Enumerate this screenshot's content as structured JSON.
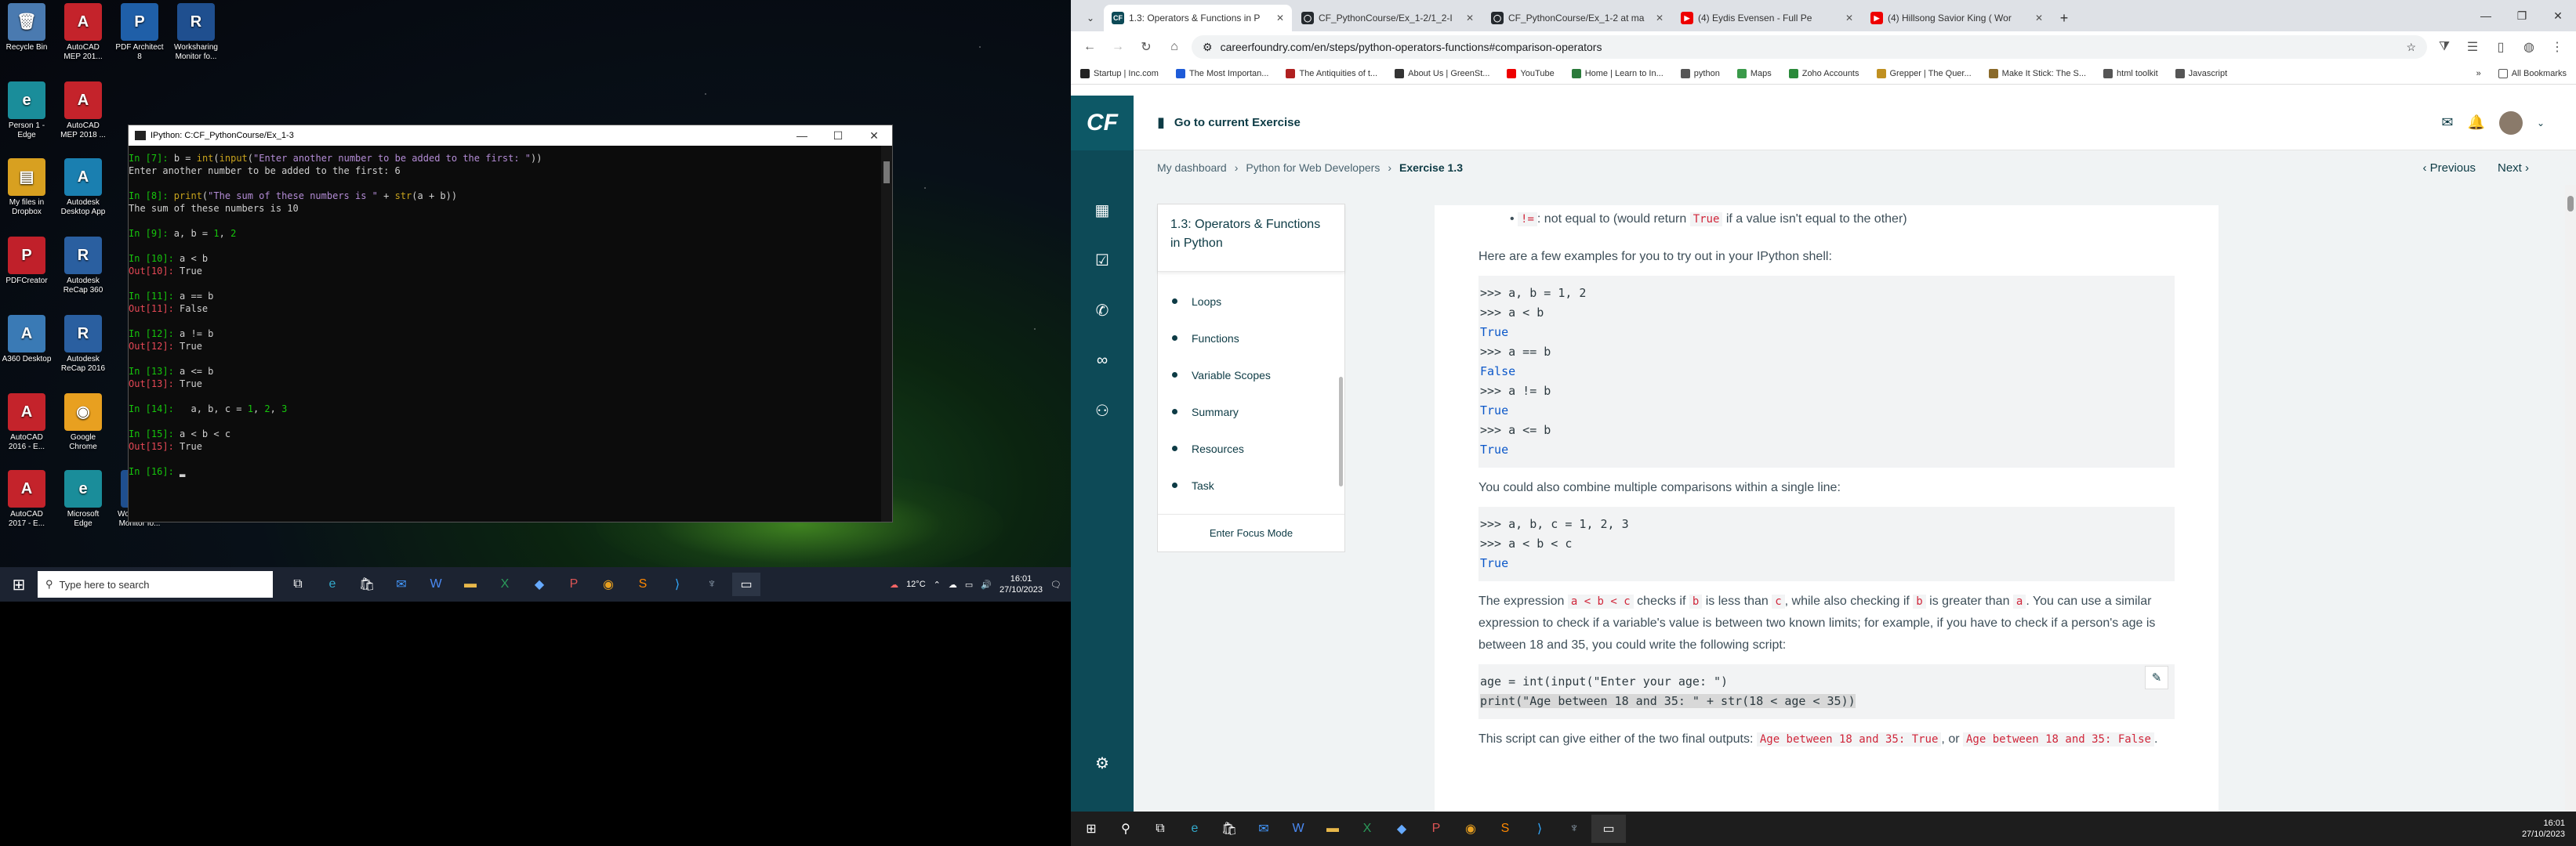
{
  "desktop": {
    "icons": [
      {
        "label": "Recycle Bin",
        "glyph": "🗑",
        "color": "#4a7ab0"
      },
      {
        "label": "AutoCAD MEP 201...",
        "glyph": "A",
        "color": "#c4232b"
      },
      {
        "label": "PDF Architect 8",
        "glyph": "P",
        "color": "#1f5fa8"
      },
      {
        "label": "Worksharing Monitor fo...",
        "glyph": "R",
        "color": "#1f4f8f"
      },
      {
        "label": "Person 1 - Edge",
        "glyph": "e",
        "color": "#1a8d9a"
      },
      {
        "label": "AutoCAD MEP 2018 ...",
        "glyph": "A",
        "color": "#c4232b"
      },
      {
        "label": "My files in Dropbox",
        "glyph": "▤",
        "color": "#d8a020"
      },
      {
        "label": "Autodesk Desktop App",
        "glyph": "A",
        "color": "#1a7fb0"
      },
      {
        "label": "PDFCreator",
        "glyph": "P",
        "color": "#c0202a"
      },
      {
        "label": "Autodesk ReCap 360",
        "glyph": "R",
        "color": "#2a5fa0"
      },
      {
        "label": "A360 Desktop",
        "glyph": "A",
        "color": "#3a7ab5"
      },
      {
        "label": "Autodesk ReCap 2016",
        "glyph": "R",
        "color": "#2a5fa0"
      },
      {
        "label": "AutoCAD 2016 - E...",
        "glyph": "A",
        "color": "#c4232b"
      },
      {
        "label": "Google Chrome",
        "glyph": "◉",
        "color": "#e8a020"
      },
      {
        "label": "AutoCAD 2017 - E...",
        "glyph": "A",
        "color": "#c4232b"
      },
      {
        "label": "Microsoft Edge",
        "glyph": "e",
        "color": "#1a8d9a"
      },
      {
        "label": "Worksharing Monitor fo...",
        "glyph": "R",
        "color": "#1f4f8f"
      }
    ]
  },
  "ipython": {
    "title": "IPython: C:CF_PythonCourse/Ex_1-3",
    "lines": [
      [
        [
          "pg",
          "In ["
        ],
        [
          "pg",
          "7"
        ],
        [
          "pg",
          "]: "
        ],
        [
          "",
          "b = "
        ],
        [
          "fn",
          "int"
        ],
        [
          "",
          "("
        ],
        [
          "fn",
          "input"
        ],
        [
          "",
          "("
        ],
        [
          "st",
          "\"Enter another number to be added to the first: \""
        ],
        [
          "",
          "))"
        ]
      ],
      [
        [
          "",
          "Enter another number to be added to the first: 6"
        ]
      ],
      [
        [
          "",
          ""
        ]
      ],
      [
        [
          "pg",
          "In [8]: "
        ],
        [
          "fn",
          "print"
        ],
        [
          "",
          "("
        ],
        [
          "st",
          "\"The sum of these numbers is \""
        ],
        [
          "",
          " + "
        ],
        [
          "fn",
          "str"
        ],
        [
          "",
          "(a + b))"
        ]
      ],
      [
        [
          "",
          "The sum of these numbers is 10"
        ]
      ],
      [
        [
          "",
          ""
        ]
      ],
      [
        [
          "pg",
          "In [9]: "
        ],
        [
          "",
          "a, b = "
        ],
        [
          "pg",
          "1"
        ],
        [
          "",
          ", "
        ],
        [
          "pg",
          "2"
        ]
      ],
      [
        [
          "",
          ""
        ]
      ],
      [
        [
          "pg",
          "In [10]: "
        ],
        [
          "",
          "a < b"
        ]
      ],
      [
        [
          "pr",
          "Out[10]: "
        ],
        [
          "",
          "True"
        ]
      ],
      [
        [
          "",
          ""
        ]
      ],
      [
        [
          "pg",
          "In [11]: "
        ],
        [
          "",
          "a == b"
        ]
      ],
      [
        [
          "pr",
          "Out[11]: "
        ],
        [
          "",
          "False"
        ]
      ],
      [
        [
          "",
          ""
        ]
      ],
      [
        [
          "pg",
          "In [12]: "
        ],
        [
          "",
          "a != b"
        ]
      ],
      [
        [
          "pr",
          "Out[12]: "
        ],
        [
          "",
          "True"
        ]
      ],
      [
        [
          "",
          ""
        ]
      ],
      [
        [
          "pg",
          "In [13]: "
        ],
        [
          "",
          "a <= b"
        ]
      ],
      [
        [
          "pr",
          "Out[13]: "
        ],
        [
          "",
          "True"
        ]
      ],
      [
        [
          "",
          ""
        ]
      ],
      [
        [
          "pg",
          "In [14]: "
        ],
        [
          "",
          "  a, b, c = "
        ],
        [
          "pg",
          "1"
        ],
        [
          "",
          ", "
        ],
        [
          "pg",
          "2"
        ],
        [
          "",
          ", "
        ],
        [
          "pg",
          "3"
        ]
      ],
      [
        [
          "",
          ""
        ]
      ],
      [
        [
          "pg",
          "In [15]: "
        ],
        [
          "",
          "a < b < c"
        ]
      ],
      [
        [
          "pr",
          "Out[15]: "
        ],
        [
          "",
          "True"
        ]
      ],
      [
        [
          "",
          ""
        ]
      ],
      [
        [
          "pg",
          "In [16]: "
        ],
        [
          "",
          "▂"
        ]
      ]
    ]
  },
  "left_taskbar": {
    "search_placeholder": "Type here to search",
    "weather": "12°C",
    "time": "16:01",
    "date": "27/10/2023"
  },
  "browser": {
    "tabs": [
      {
        "label": "1.3: Operators & Functions in P",
        "fav": "CF",
        "color": "#0d4a57"
      },
      {
        "label": "CF_PythonCourse/Ex_1-2/1_2-I",
        "fav": "◯",
        "color": "#24292e"
      },
      {
        "label": "CF_PythonCourse/Ex_1-2 at ma",
        "fav": "◯",
        "color": "#24292e"
      },
      {
        "label": "(4) Eydis Evensen - Full Pe",
        "fav": "▶",
        "color": "#e00"
      },
      {
        "label": "(4) Hillsong Savior King ( Wor",
        "fav": "▶",
        "color": "#e00"
      }
    ],
    "url": "careerfoundry.com/en/steps/python-operators-functions#comparison-operators",
    "bookmarks": [
      {
        "label": "Startup | Inc.com",
        "color": "#222"
      },
      {
        "label": "The Most Importan...",
        "color": "#1e5bd8"
      },
      {
        "label": "The Antiquities of t...",
        "color": "#b02020"
      },
      {
        "label": "About Us | GreenSt...",
        "color": "#333"
      },
      {
        "label": "YouTube",
        "color": "#e00"
      },
      {
        "label": "Home | Learn to In...",
        "color": "#2a7a3a"
      },
      {
        "label": "python",
        "color": "#555"
      },
      {
        "label": "Maps",
        "color": "#3a9a4a"
      },
      {
        "label": "Zoho Accounts",
        "color": "#2a8a3a"
      },
      {
        "label": "Grepper | The Quer...",
        "color": "#c09020"
      },
      {
        "label": "Make It Stick: The S...",
        "color": "#8a6a2a"
      },
      {
        "label": "html toolkit",
        "color": "#555"
      },
      {
        "label": "Javascript",
        "color": "#555"
      }
    ],
    "all_bookmarks": "All Bookmarks"
  },
  "cf": {
    "logo": "CF",
    "go_current": "Go to current Exercise",
    "crumbs": {
      "dashboard": "My dashboard",
      "course": "Python for Web Developers",
      "current": "Exercise 1.3"
    },
    "prev": "Previous",
    "next": "Next",
    "sidebar": {
      "title": "1.3: Operators & Functions in Python",
      "items": [
        "Loops",
        "Functions",
        "Variable Scopes",
        "Summary",
        "Resources",
        "Task"
      ],
      "focus": "Enter Focus Mode"
    },
    "article": {
      "bullet_code": "!=",
      "bullet_text": ": not equal to (would return ",
      "bullet_true": "True",
      "bullet_end": " if a value isn't equal to the other)",
      "p1": "Here are a few examples for you to try out in your IPython shell:",
      "code1": [
        ">>> a, b = 1, 2",
        ">>> a < b",
        "True",
        ">>> a == b",
        "False",
        ">>> a != b",
        "True",
        ">>> a <= b",
        "True"
      ],
      "p2": "You could also combine multiple comparisons within a single line:",
      "code2": [
        ">>> a, b, c = 1, 2, 3",
        ">>> a < b < c",
        "True"
      ],
      "p3a": "The expression ",
      "p3c1": "a < b < c",
      "p3b": " checks if ",
      "p3c2": "b",
      "p3c": " is less than ",
      "p3c3": "c",
      "p3d": ", while also checking if ",
      "p3c4": "b",
      "p3e": " is greater than ",
      "p3c5": "a",
      "p3f": ". You can use a similar expression to check if a variable's value is between two known limits; for example, if you have to check if a person's age is between 18 and 35, you could write the following script:",
      "code3": [
        "age = int(input(\"Enter your age: \")",
        "print(\"Age between 18 and 35: \" + str(18 < age < 35))"
      ],
      "p4a": "This script can give either of the two final outputs: ",
      "p4c1": "Age between 18 and 35: True",
      "p4b": ", or ",
      "p4c2": "Age between 18 and 35: False",
      "p4d": "."
    }
  },
  "right_taskbar": {
    "time": "16:01",
    "date": "27/10/2023"
  }
}
